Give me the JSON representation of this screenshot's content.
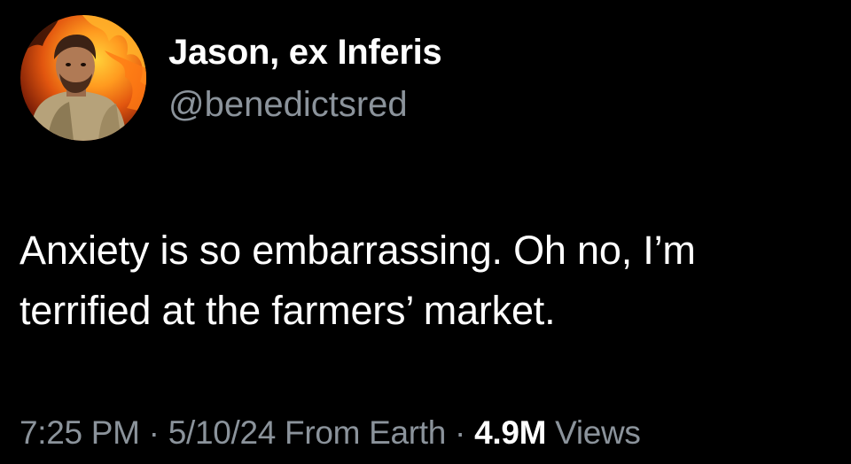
{
  "author": {
    "display_name": "Jason, ex Inferis",
    "handle": "@benedictsred",
    "avatar_icon": "profile-photo-flames"
  },
  "tweet": {
    "text_line1": "Anxiety is so embarrassing. Oh no, I’m",
    "text_line2": "terrified at the farmers’ market."
  },
  "meta": {
    "time": "7:25 PM",
    "separator1": " · ",
    "date": "5/10/24",
    "location": " From Earth",
    "separator2": " · ",
    "views_count": "4.9M",
    "views_label": " Views"
  },
  "colors": {
    "background": "#000000",
    "primary_text": "#ffffff",
    "secondary_text": "#8b939b"
  }
}
